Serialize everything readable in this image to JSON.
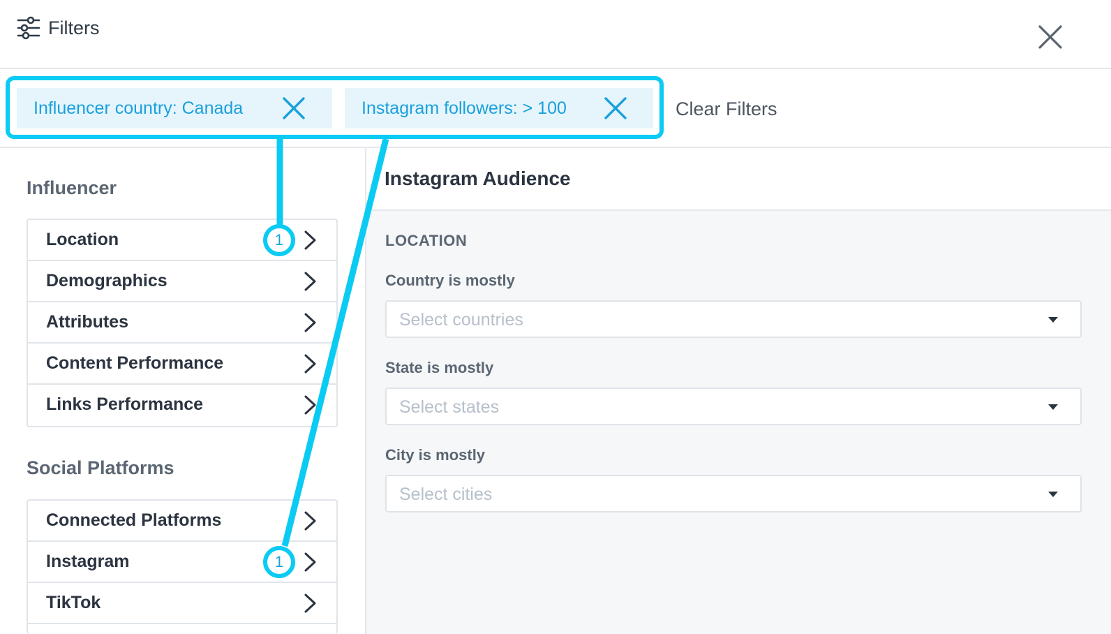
{
  "header": {
    "title": "Filters",
    "icon": "sliders-icon",
    "close_icon": "close-icon"
  },
  "chips": [
    {
      "label": "Influencer country: Canada"
    },
    {
      "label": "Instagram followers: > 100"
    }
  ],
  "clear_filters_label": "Clear Filters",
  "sidebar": {
    "influencer_title": "Influencer",
    "influencer_items": [
      {
        "label": "Location",
        "badge": "1"
      },
      {
        "label": "Demographics"
      },
      {
        "label": "Attributes"
      },
      {
        "label": "Content Performance"
      },
      {
        "label": "Links Performance"
      }
    ],
    "social_title": "Social Platforms",
    "social_items": [
      {
        "label": "Connected Platforms"
      },
      {
        "label": "Instagram",
        "badge": "1"
      },
      {
        "label": "TikTok"
      }
    ]
  },
  "panel": {
    "title": "Instagram Audience",
    "section": "LOCATION",
    "fields": [
      {
        "label": "Country is mostly",
        "placeholder": "Select countries"
      },
      {
        "label": "State is mostly",
        "placeholder": "Select states"
      },
      {
        "label": "City is mostly",
        "placeholder": "Select cities"
      }
    ]
  },
  "colors": {
    "accent": "#0ccbf3",
    "chip_text": "#1aa0dc",
    "chip_bg": "#e6f5fc"
  }
}
